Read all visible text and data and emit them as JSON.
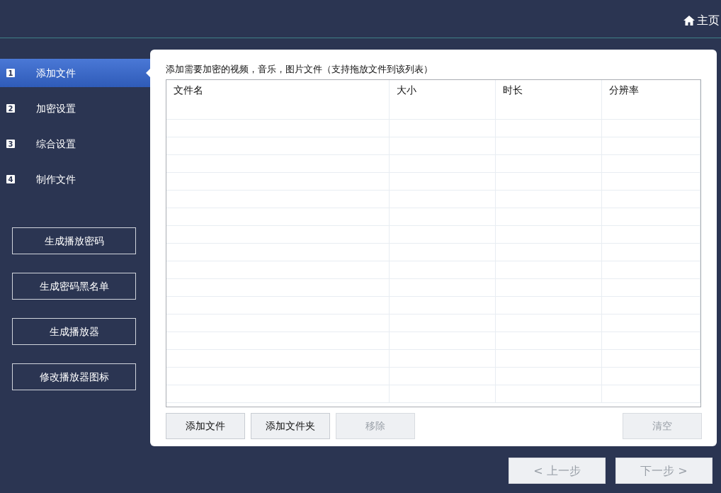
{
  "header": {
    "home_link": "主页"
  },
  "steps": [
    {
      "number": "1",
      "label": "添加文件",
      "selected": true
    },
    {
      "number": "2",
      "label": "加密设置",
      "selected": false
    },
    {
      "number": "3",
      "label": "综合设置",
      "selected": false
    },
    {
      "number": "4",
      "label": "制作文件",
      "selected": false
    }
  ],
  "side_buttons": [
    "生成播放密码",
    "生成密码黑名单",
    "生成播放器",
    "修改播放器图标"
  ],
  "panel": {
    "instruction": "添加需要加密的视频，音乐，图片文件（支持拖放文件到该列表）",
    "table": {
      "columns": [
        "文件名",
        "大小",
        "时长",
        "分辨率"
      ]
    },
    "buttons": [
      {
        "label": "添加文件",
        "disabled": false
      },
      {
        "label": "添加文件夹",
        "disabled": false
      },
      {
        "label": "移除",
        "disabled": true
      }
    ],
    "right_buttons": [
      {
        "label": "清空",
        "disabled": true
      }
    ]
  },
  "nav_buttons": [
    {
      "label": "< 上一步",
      "disabled": true
    },
    {
      "label": "下一步 >",
      "disabled": true
    }
  ]
}
